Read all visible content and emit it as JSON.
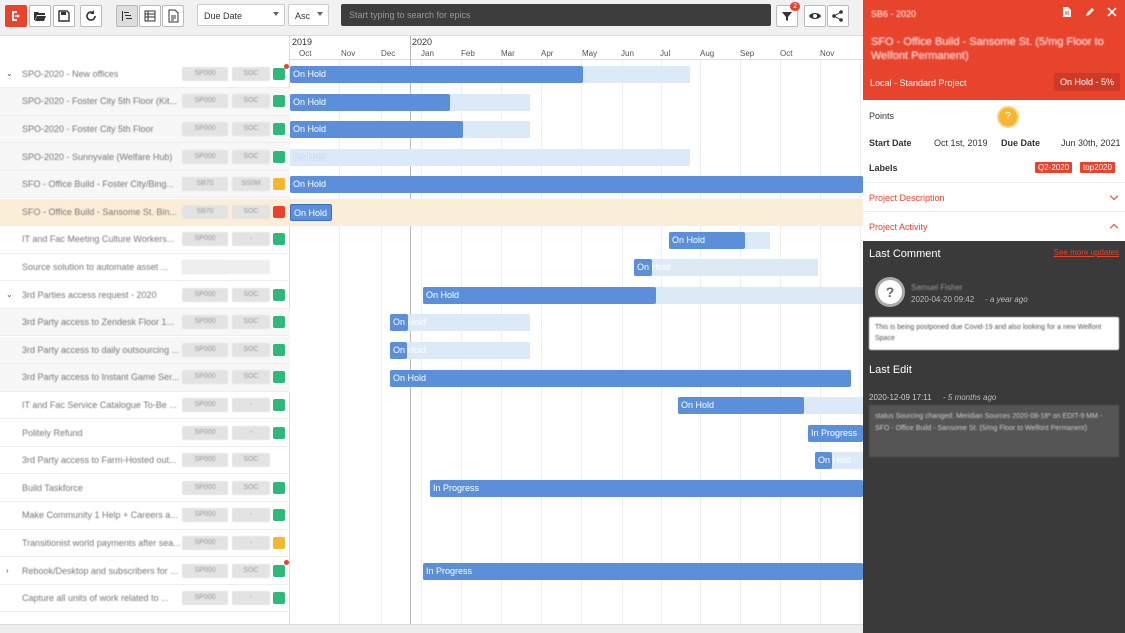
{
  "toolbar": {
    "sort_field": "Due Date",
    "sort_order": "Asc",
    "search_placeholder": "Start typing to search for epics",
    "filter_badge": "2"
  },
  "timeline": {
    "years": [
      "2019",
      "2020"
    ],
    "months": [
      "Oct",
      "Nov",
      "Dec",
      "Jan",
      "Feb",
      "Mar",
      "Apr",
      "May",
      "Jun",
      "Jul",
      "Aug",
      "Sep",
      "Oct",
      "Nov"
    ]
  },
  "rows": [
    {
      "title": "SPO-2020 - New offices",
      "c1": "SP000",
      "c2": "SOC",
      "status_color": "#2eb87a",
      "expander": "expanded",
      "dot": true
    },
    {
      "title": "SPO-2020 - Foster City 5th Floor (Kit...",
      "c1": "SP000",
      "c2": "SOC",
      "status_color": "#2eb87a",
      "child": true
    },
    {
      "title": "SPO-2020 - Foster City 5th Floor",
      "c1": "SP000",
      "c2": "SOC",
      "status_color": "#2eb87a",
      "child": true
    },
    {
      "title": "SPO-2020 - Sunnyvale (Welfare Hub)",
      "c1": "SP000",
      "c2": "SOC",
      "status_color": "#2eb87a",
      "child": true
    },
    {
      "title": "SFO - Office Build - Foster City/Bing...",
      "c1": "SB70",
      "c2": "SS0M",
      "status_color": "#f5b731",
      "child": true
    },
    {
      "title": "SFO - Office Build - Sansome St. Bin...",
      "c1": "SB70",
      "c2": "SOC",
      "status_color": "#e8432d",
      "child": true,
      "highlight": true
    },
    {
      "title": "IT and Fac Meeting Culture Workers...",
      "c1": "SP000",
      "c2": "-",
      "status_color": "#2eb87a"
    },
    {
      "title": "Source solution to automate asset ...",
      "c1": "SP000",
      "c2": "",
      "status_color": ""
    },
    {
      "title": "3rd Parties access request - 2020",
      "c1": "SP000",
      "c2": "SOC",
      "status_color": "#2eb87a",
      "expander": "expanded"
    },
    {
      "title": "3rd Party access to Zendesk Floor 1...",
      "c1": "SP000",
      "c2": "SOC",
      "status_color": "#2eb87a",
      "child": true
    },
    {
      "title": "3rd Party access to daily outsourcing ...",
      "c1": "SP000",
      "c2": "SOC",
      "status_color": "#2eb87a",
      "child": true
    },
    {
      "title": "3rd Party access to Instant Game Ser...",
      "c1": "SP000",
      "c2": "SOC",
      "status_color": "#2eb87a",
      "child": true
    },
    {
      "title": "IT and Fac Service Catalogue To-Be ...",
      "c1": "SP000",
      "c2": "-",
      "status_color": "#2eb87a"
    },
    {
      "title": "Politely Refund",
      "c1": "SP000",
      "c2": "-",
      "status_color": "#2eb87a"
    },
    {
      "title": "3rd Party access to Farm-Hosted out...",
      "c1": "SP000",
      "c2": "SOC",
      "status_color": ""
    },
    {
      "title": "Build Taskforce",
      "c1": "SP000",
      "c2": "SOC",
      "status_color": "#2eb87a"
    },
    {
      "title": "Make Community 1 Help + Careers a...",
      "c1": "SP000",
      "c2": "-",
      "status_color": "#2eb87a"
    },
    {
      "title": "Transitionist world payments after sea...",
      "c1": "SP000",
      "c2": "-",
      "status_color": "#f5b731"
    },
    {
      "title": "Rebook/Desktop and subscribers for ...",
      "c1": "SP000",
      "c2": "SOC",
      "status_color": "#2eb87a",
      "expander": "collapsed",
      "dot": true
    },
    {
      "title": "Capture all units of work related to ...",
      "c1": "SP000",
      "c2": "-",
      "status_color": "#2eb87a"
    }
  ],
  "bars": [
    {
      "label": "On Hold"
    },
    {
      "label": "On Hold"
    },
    {
      "label": "On Hold"
    },
    {
      "label": "On Hold"
    },
    {
      "label": "On Hold"
    },
    {
      "label": "On Hold"
    },
    {
      "label": "On Hold"
    },
    {
      "label": "On Hold"
    },
    {
      "label": "On Hold"
    },
    {
      "label": "On Hold"
    },
    {
      "label": "On Hold"
    },
    {
      "label": "On Hold"
    },
    {
      "label": "On Hold"
    },
    {
      "label": "In Progress"
    },
    {
      "label": "On Hold"
    },
    {
      "label": "In Progress"
    },
    {
      "label": "In Progress"
    }
  ],
  "panel": {
    "epic_key": "SB6 - 2020",
    "title": "SFO - Office Build - Sansome St. (5/mg Floor to Welfont Permanent)",
    "project_type": "Local - Standard Project",
    "status": "On Hold - 5%",
    "points_label": "Points",
    "points_value": "?",
    "start_label": "Start Date",
    "start_value": "Oct 1st, 2019",
    "due_label": "Due Date",
    "due_value": "Jun 30th, 2021",
    "labels_label": "Labels",
    "labels": [
      "Q2-2020",
      "top2020"
    ],
    "description_label": "Project Description",
    "activity_label": "Project Activity",
    "last_comment_label": "Last Comment",
    "see_more": "See more updates",
    "comment_author": "Samuel Fisher",
    "comment_time": "2020-04-20 09:42",
    "comment_ago": "a year ago",
    "comment_text": "This is being postponed due Covid-19 and also looking for a new Welfont Space",
    "last_edit_label": "Last Edit",
    "edit_time": "2020-12-09 17:11",
    "edit_ago": "5 months ago",
    "edit_text": "status Sourcing changed: Meridian Sources 2020-08-18* on EDIT-9 MM - SFO - Office Build - Sansome St. (5/mg Floor to Welfont Permanent)"
  },
  "colors": {
    "accent": "#e8432d",
    "bar": "#5b8fd9",
    "track": "#dce9f6",
    "green": "#2eb87a",
    "yellow": "#f5b731"
  }
}
